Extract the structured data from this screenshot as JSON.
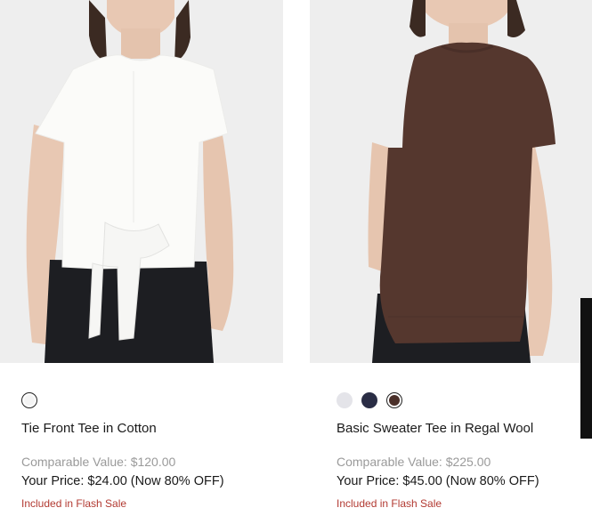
{
  "products": [
    {
      "name": "Tie Front Tee in Cotton",
      "comparable": "Comparable Value: $120.00",
      "price": "Your Price: $24.00 (Now 80% OFF)",
      "flash": "Included in Flash Sale",
      "swatches": [
        {
          "color": "#f4f4f4",
          "selected": true
        }
      ]
    },
    {
      "name": "Basic Sweater Tee in Regal Wool",
      "comparable": "Comparable Value: $225.00",
      "price": "Your Price: $45.00 (Now 80% OFF)",
      "flash": "Included in Flash Sale",
      "swatches": [
        {
          "color": "#e4e4e9",
          "selected": false
        },
        {
          "color": "#2a2d45",
          "selected": false
        },
        {
          "color": "#4a2f29",
          "selected": true
        }
      ]
    }
  ],
  "colors": {
    "image_bg": "#eeeeee",
    "white_tee": "#fbfbf9",
    "brown_tee": "#55372e",
    "pants": "#1d1e22",
    "skin": "#e8c8b3",
    "hair": "#3b2a22",
    "flash_text": "#b23a32"
  }
}
